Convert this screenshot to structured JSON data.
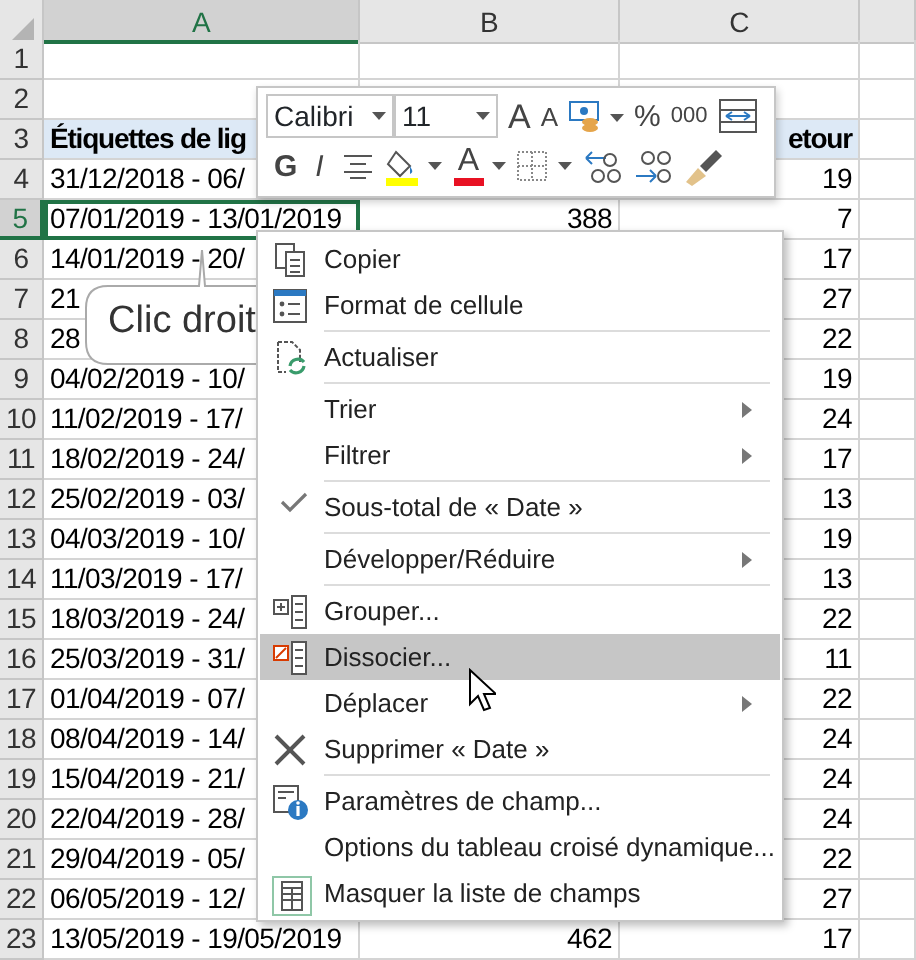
{
  "sheet": {
    "columns": [
      {
        "label": "A",
        "selected": true
      },
      {
        "label": "B",
        "selected": false
      },
      {
        "label": "C",
        "selected": false
      }
    ],
    "rows": [
      {
        "number": "1",
        "selected": false,
        "kind": "data"
      },
      {
        "number": "2",
        "selected": false,
        "kind": "data"
      },
      {
        "number": "3",
        "selected": false,
        "kind": "header",
        "a": "Étiquettes de lig",
        "c": "etour"
      },
      {
        "number": "4",
        "selected": false,
        "kind": "data",
        "a": "31/12/2018 - 06/",
        "c": "19"
      },
      {
        "number": "5",
        "selected": true,
        "kind": "data",
        "a": "07/01/2019 - 13/01/2019",
        "b": "388",
        "c": "7"
      },
      {
        "number": "6",
        "selected": false,
        "kind": "data",
        "a": "14/01/2019 - 20/",
        "c": "17"
      },
      {
        "number": "7",
        "selected": false,
        "kind": "data",
        "a": "21",
        "c": "27"
      },
      {
        "number": "8",
        "selected": false,
        "kind": "data",
        "a": "28",
        "c": "22"
      },
      {
        "number": "9",
        "selected": false,
        "kind": "data",
        "a": "04/02/2019 - 10/",
        "c": "19"
      },
      {
        "number": "10",
        "selected": false,
        "kind": "data",
        "a": "11/02/2019 - 17/",
        "c": "24"
      },
      {
        "number": "11",
        "selected": false,
        "kind": "data",
        "a": "18/02/2019 - 24/",
        "c": "17"
      },
      {
        "number": "12",
        "selected": false,
        "kind": "data",
        "a": "25/02/2019 - 03/",
        "c": "13"
      },
      {
        "number": "13",
        "selected": false,
        "kind": "data",
        "a": "04/03/2019 - 10/",
        "c": "19"
      },
      {
        "number": "14",
        "selected": false,
        "kind": "data",
        "a": "11/03/2019 - 17/",
        "c": "13"
      },
      {
        "number": "15",
        "selected": false,
        "kind": "data",
        "a": "18/03/2019 - 24/",
        "c": "22"
      },
      {
        "number": "16",
        "selected": false,
        "kind": "data",
        "a": "25/03/2019 - 31/",
        "c": "11"
      },
      {
        "number": "17",
        "selected": false,
        "kind": "data",
        "a": "01/04/2019 - 07/",
        "c": "22"
      },
      {
        "number": "18",
        "selected": false,
        "kind": "data",
        "a": "08/04/2019 - 14/",
        "c": "24"
      },
      {
        "number": "19",
        "selected": false,
        "kind": "data",
        "a": "15/04/2019 - 21/",
        "c": "24"
      },
      {
        "number": "20",
        "selected": false,
        "kind": "data",
        "a": "22/04/2019 - 28/",
        "c": "24"
      },
      {
        "number": "21",
        "selected": false,
        "kind": "data",
        "a": "29/04/2019 - 05/",
        "c": "22"
      },
      {
        "number": "22",
        "selected": false,
        "kind": "data",
        "a": "06/05/2019 - 12/",
        "c": "27"
      },
      {
        "number": "23",
        "selected": false,
        "kind": "data",
        "a": "13/05/2019 - 19/05/2019",
        "b": "462",
        "c": "17"
      }
    ]
  },
  "mini_toolbar": {
    "font": "Calibri",
    "size": "11",
    "grow": "A",
    "shrink": "A",
    "percent": "%",
    "thousands": "000",
    "bold": "G",
    "italic": "I",
    "font_color": "A"
  },
  "callout": {
    "text": "Clic droit"
  },
  "context_menu": [
    {
      "label": "Copier",
      "submenu": false,
      "checked": false,
      "selected": false,
      "separator_before": false
    },
    {
      "label": "Format de cellule",
      "submenu": false,
      "checked": false,
      "selected": false,
      "separator_before": false
    },
    {
      "label": "Actualiser",
      "submenu": false,
      "checked": false,
      "selected": false,
      "separator_before": true
    },
    {
      "label": "Trier",
      "submenu": true,
      "checked": false,
      "selected": false,
      "separator_before": true
    },
    {
      "label": "Filtrer",
      "submenu": true,
      "checked": false,
      "selected": false,
      "separator_before": false
    },
    {
      "label": "Sous-total de « Date »",
      "submenu": false,
      "checked": true,
      "selected": false,
      "separator_before": true
    },
    {
      "label": "Développer/Réduire",
      "submenu": true,
      "checked": false,
      "selected": false,
      "separator_before": true
    },
    {
      "label": "Grouper...",
      "submenu": false,
      "checked": false,
      "selected": false,
      "separator_before": true
    },
    {
      "label": "Dissocier...",
      "submenu": false,
      "checked": false,
      "selected": true,
      "separator_before": false
    },
    {
      "label": "Déplacer",
      "submenu": true,
      "checked": false,
      "selected": false,
      "separator_before": false
    },
    {
      "label": "Supprimer « Date »",
      "submenu": false,
      "checked": false,
      "selected": false,
      "separator_before": false
    },
    {
      "label": "Paramètres de champ...",
      "submenu": false,
      "checked": false,
      "selected": false,
      "separator_before": true
    },
    {
      "label": "Options du tableau croisé dynamique...",
      "submenu": false,
      "checked": false,
      "selected": false,
      "separator_before": false
    },
    {
      "label": "Masquer la liste de champs",
      "submenu": false,
      "checked": false,
      "selected": false,
      "separator_before": false
    }
  ]
}
